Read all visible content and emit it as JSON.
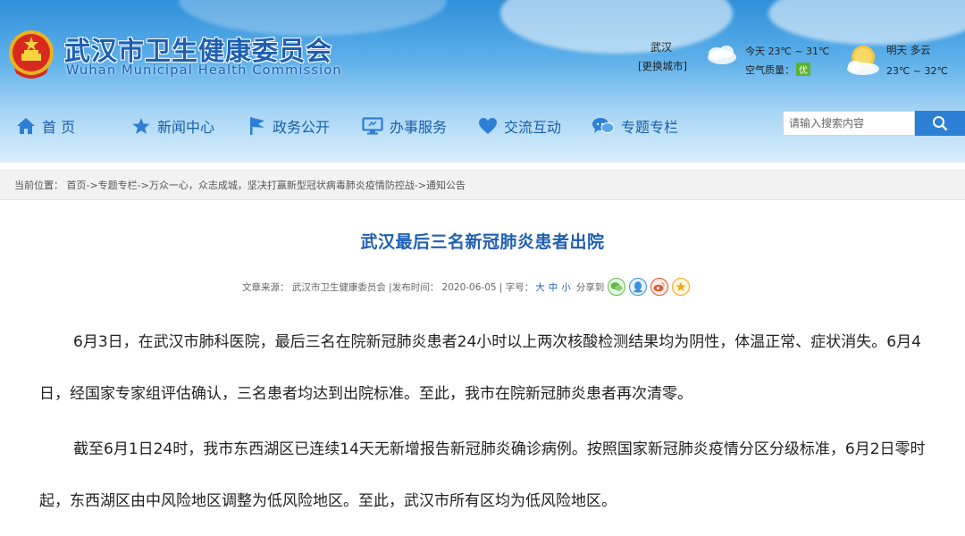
{
  "header": {
    "title": "武汉市卫生健康委员会",
    "subtitle": "Wuhan Municipal Health Commission",
    "city": "武汉",
    "change_city": "[更换城市]",
    "weather_today": "今天 23℃ ~ 31℃",
    "aqi_label": "空气质量：",
    "aqi_value": "优",
    "weather_tomorrow": "明天 多云",
    "tomorrow_temp": "23℃ ~ 32℃"
  },
  "nav": {
    "items": [
      {
        "label": "首 页",
        "icon": "home-icon"
      },
      {
        "label": "新闻中心",
        "icon": "star-icon"
      },
      {
        "label": "政务公开",
        "icon": "flag-icon"
      },
      {
        "label": "办事服务",
        "icon": "monitor-icon"
      },
      {
        "label": "交流互动",
        "icon": "heart-icon"
      },
      {
        "label": "专题专栏",
        "icon": "chat-icon"
      }
    ]
  },
  "search": {
    "placeholder": "请输入搜索内容"
  },
  "breadcrumb": {
    "label": "当前位置：",
    "path": "首页->专题专栏->万众一心，众志成城，坚决打赢新型冠状病毒肺炎疫情防控战->通知公告"
  },
  "article": {
    "title": "武汉最后三名新冠肺炎患者出院",
    "source": "文章来源：  武汉市卫生健康委员会  |发布时间：  2020-06-05   |  字号：",
    "font_large": "大",
    "font_medium": "中",
    "font_small": "小",
    "share_label": "分享到",
    "paragraphs": [
      "6月3日，在武汉市肺科医院，最后三名在院新冠肺炎患者24小时以上两次核酸检测结果均为阴性，体温正常、症状消失。6月4日，经国家专家组评估确认，三名患者均达到出院标准。至此，我市在院新冠肺炎患者再次清零。",
      "截至6月1日24时，我市东西湖区已连续14天无新增报告新冠肺炎确诊病例。按照国家新冠肺炎疫情分区分级标准，6月2日零时起，东西湖区由中风险地区调整为低风险地区。至此，武汉市所有区均为低风险地区。"
    ]
  },
  "colors": {
    "brand_blue": "#1e5fb4",
    "title_blue": "#1f5fb3",
    "search_button": "#2d7fd6",
    "aqi_green": "#5cb230"
  }
}
